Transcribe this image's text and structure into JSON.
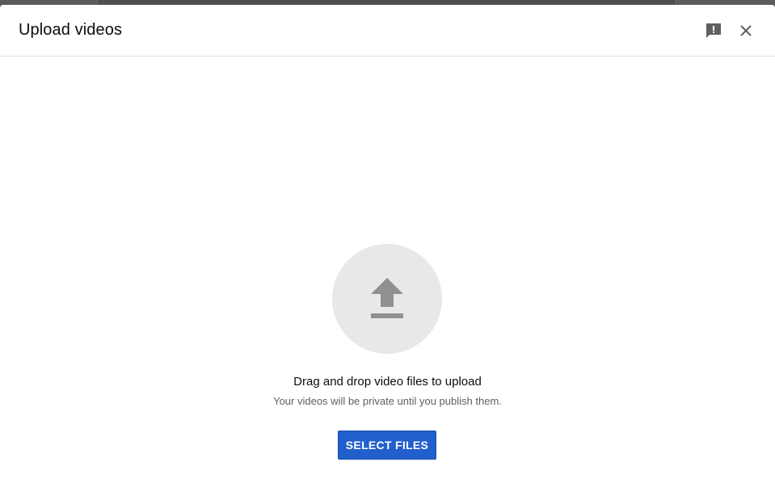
{
  "dialog": {
    "title": "Upload videos",
    "feedback_icon": "feedback-icon",
    "close_icon": "close-icon"
  },
  "upload": {
    "icon": "upload-arrow-icon",
    "primary_text": "Drag and drop video files to upload",
    "secondary_text": "Your videos will be private until you publish them.",
    "button_label": "SELECT FILES"
  },
  "colors": {
    "accent": "#2160cc",
    "icon_gray": "#909090",
    "circle_bg": "#e8e8e8"
  }
}
